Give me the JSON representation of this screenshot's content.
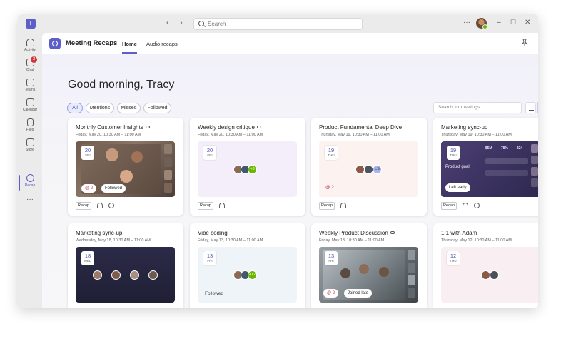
{
  "titlebar": {
    "search_placeholder": "Search",
    "more": "···"
  },
  "rail": [
    {
      "label": "Activity",
      "icon": "bell-icon"
    },
    {
      "label": "Chat",
      "icon": "chat-icon",
      "badge": "2"
    },
    {
      "label": "Teams",
      "icon": "teams-icon"
    },
    {
      "label": "Calendar",
      "icon": "calendar-icon"
    },
    {
      "label": "Files",
      "icon": "file-icon"
    },
    {
      "label": "Store",
      "icon": "store-icon"
    },
    {
      "label": "Recap",
      "icon": "recap-icon"
    }
  ],
  "rail_more": "···",
  "app": {
    "title": "Meeting Recaps",
    "tabs": [
      "Home",
      "Audio recaps"
    ]
  },
  "greeting": "Good morning, Tracy",
  "filters": [
    "All",
    "Mentions",
    "Missed",
    "Followed"
  ],
  "search_meetings_placeholder": "Search for meetings",
  "recap_label": "Recap",
  "cards": [
    {
      "title": "Monthly Customer Insights",
      "subtitle": "Friday, May 20, 10:30 AM – 11:00 AM",
      "day": "20",
      "weekday": "FRI",
      "mentions": "2",
      "tag": "Followed"
    },
    {
      "title": "Weekly design critique",
      "subtitle": "Friday, May 20, 10:30 AM – 11:00 AM",
      "day": "20",
      "weekday": "FRI",
      "more": "+3"
    },
    {
      "title": "Product Fundamental Deep Dive",
      "subtitle": "Thursday, May 19, 10:30 AM – 11:00 AM",
      "day": "19",
      "weekday": "THU",
      "mentions": "2",
      "initials": "LS"
    },
    {
      "title": "Marketing sync-up",
      "subtitle": "Thursday, May 19, 10:30 AM – 11:00 AM",
      "day": "19",
      "weekday": "THU",
      "tag": "Left early",
      "dash": {
        "m1": "$5M",
        "m2": "78%",
        "m3": "324",
        "label": "Product goal"
      }
    },
    {
      "title": "Marketing sync-up",
      "subtitle": "Wednesday, May 18, 10:30 AM – 11:00 AM",
      "day": "18",
      "weekday": "WED"
    },
    {
      "title": "Vibe coding",
      "subtitle": "Friday, May 13, 10:30 AM – 11:00 AM",
      "day": "13",
      "weekday": "FRI",
      "more": "+12",
      "tag": "Followed"
    },
    {
      "title": "Weekly Product Discussion",
      "subtitle": "Friday, May 13, 10:30 AM – 11:00 AM",
      "day": "13",
      "weekday": "FRI",
      "mentions": "2",
      "tag": "Joined late"
    },
    {
      "title": "1:1 with Adam",
      "subtitle": "Thursday, May 12, 10:30 AM – 11:00 AM",
      "day": "12",
      "weekday": "THU"
    }
  ],
  "colors": {
    "accent": "#5b5fc7",
    "mention": "#c4314b"
  }
}
